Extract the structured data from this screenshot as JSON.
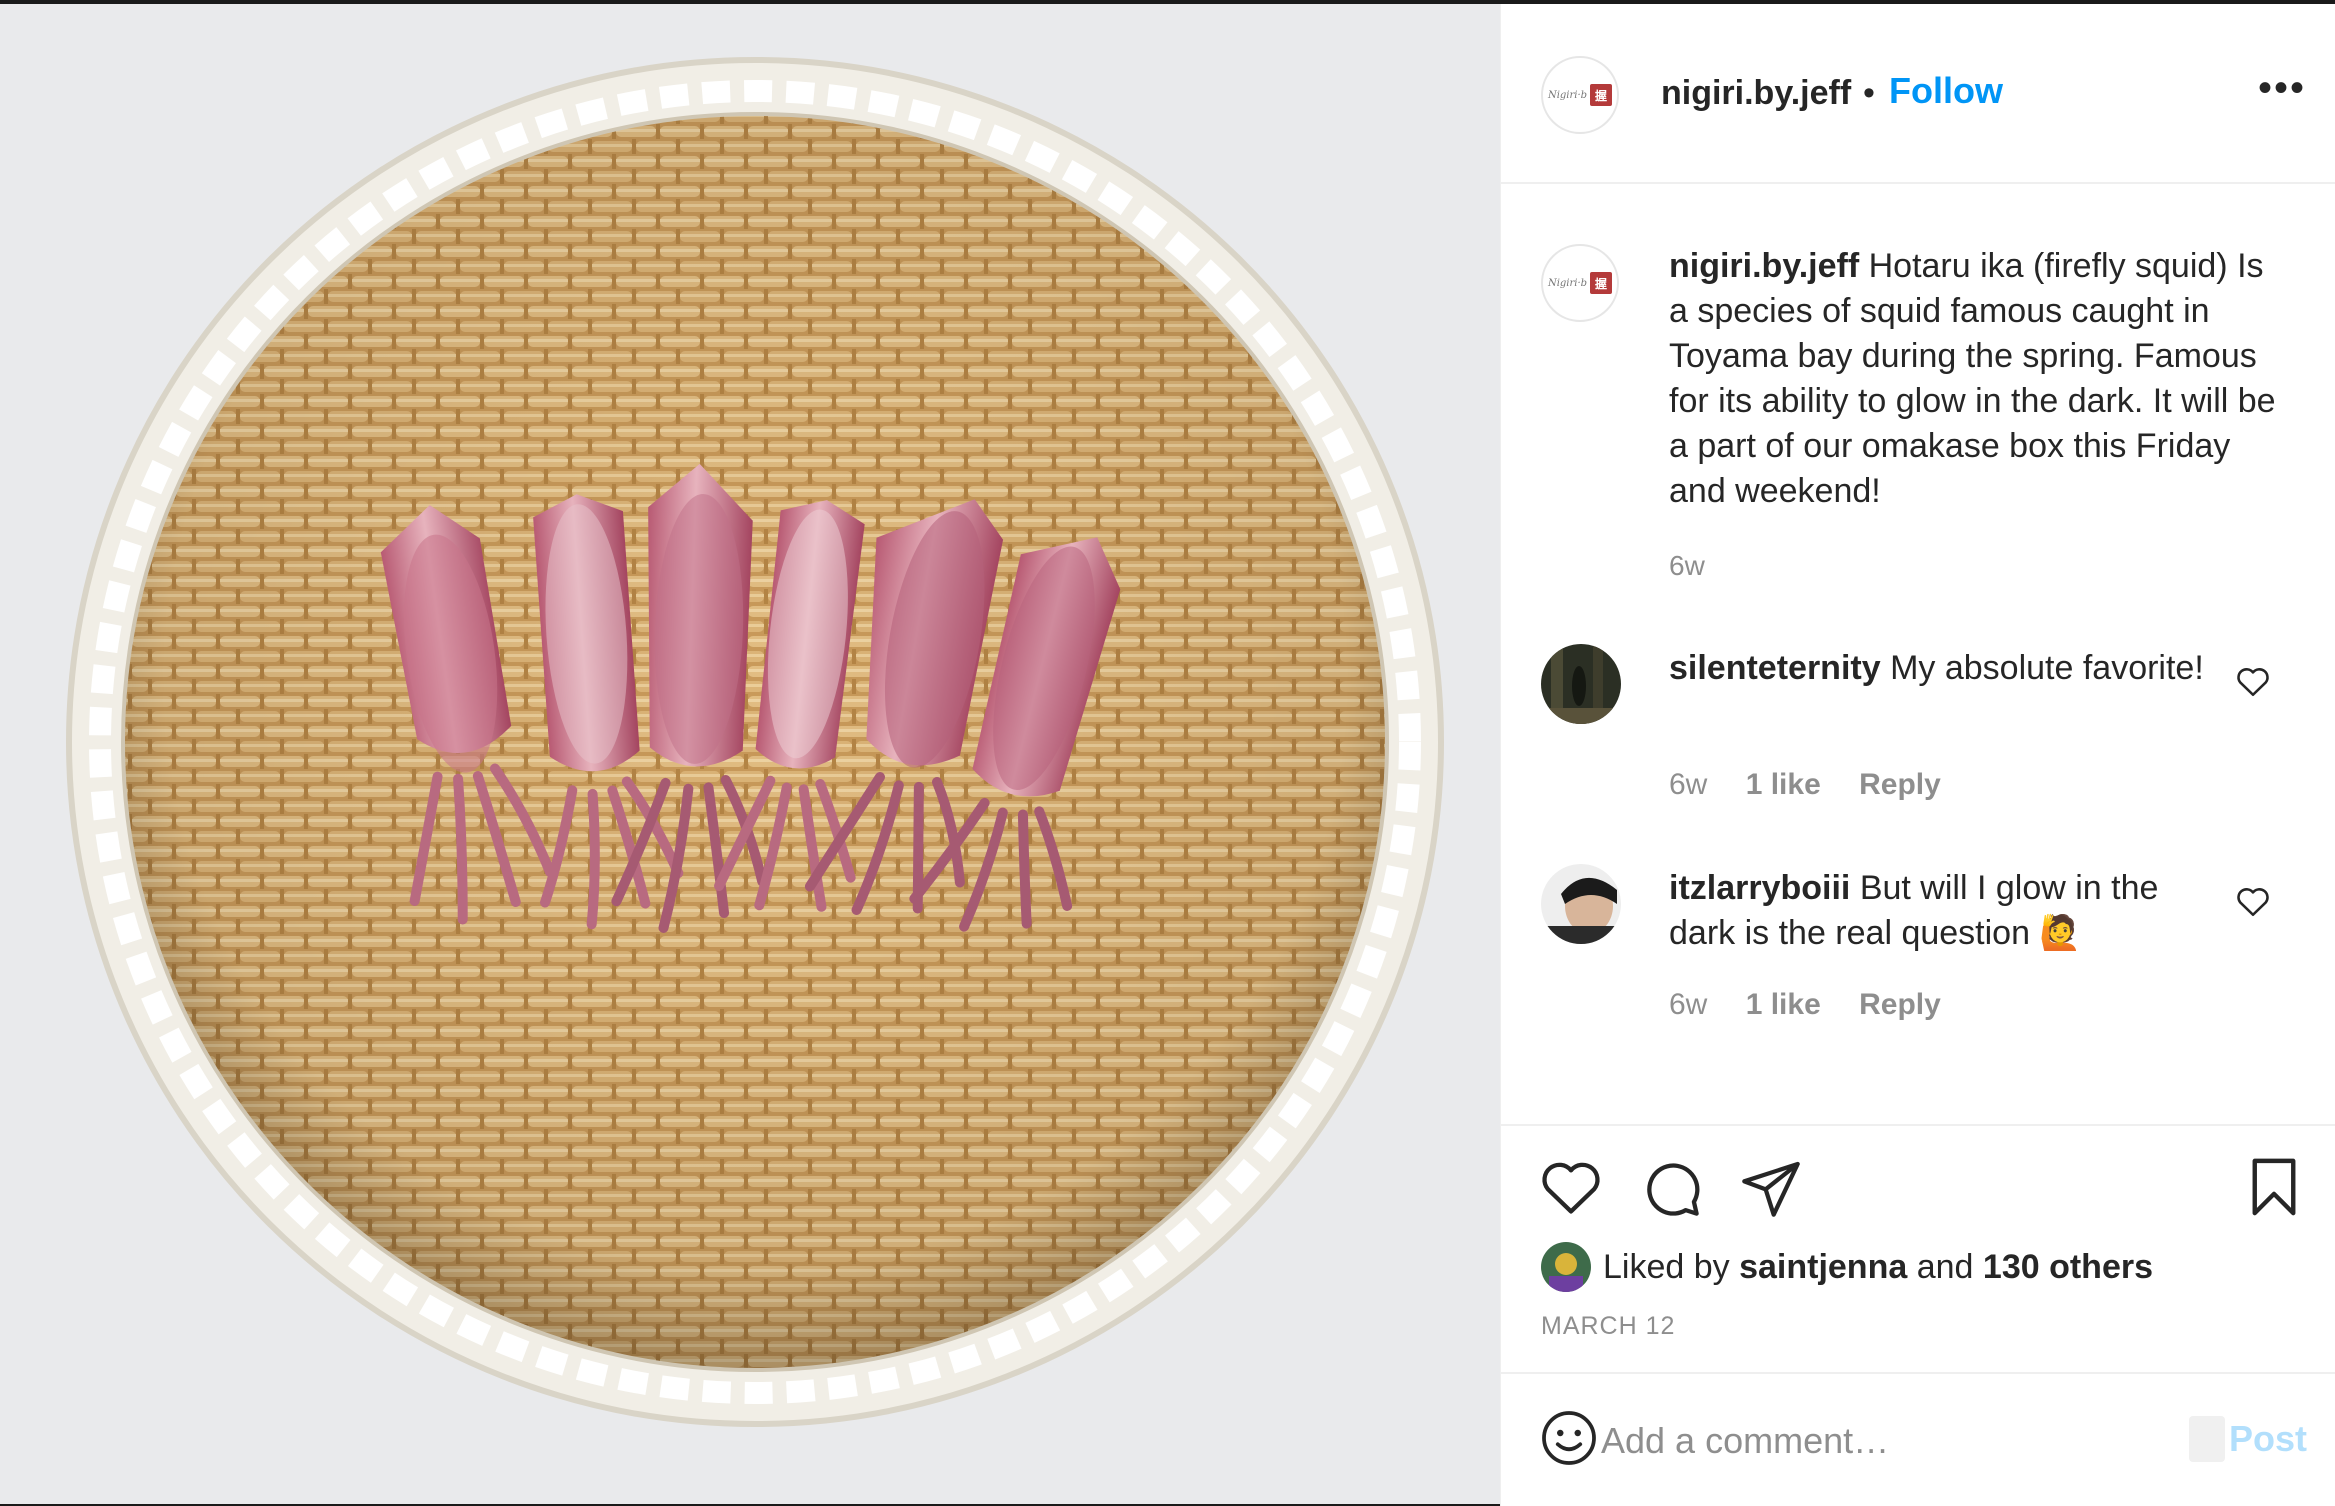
{
  "post": {
    "username": "nigiri.by.jeff",
    "follow_label": "Follow",
    "dot": "•",
    "more_label": "•••",
    "brand_avatar_script": "Nigiri·b",
    "brand_avatar_mark": "握"
  },
  "caption": {
    "username": "nigiri.by.jeff",
    "text": "Hotaru ika (firefly squid) Is a species of squid famous caught in Toyama bay during the spring. Famous for its ability to glow in the dark. It will be a part of our omakase box this Friday and weekend!",
    "time": "6w"
  },
  "comments": [
    {
      "username": "silenteternity",
      "text": "My absolute favorite!",
      "time": "6w",
      "likes": "1 like",
      "reply": "Reply"
    },
    {
      "username": "itzlarryboiii",
      "text": "But will I glow in the dark is the real question 🙋",
      "time": "6w",
      "likes": "1 like",
      "reply": "Reply"
    }
  ],
  "actions": {
    "liked_prefix": "Liked by",
    "liked_user": "saintjenna",
    "liked_and": "and",
    "liked_others": "130 others",
    "date": "MARCH 12"
  },
  "add_comment": {
    "placeholder": "Add a comment…",
    "post_label": "Post"
  },
  "icons": {
    "like": "heart-icon",
    "comment": "comment-icon",
    "share": "paper-plane-icon",
    "save": "bookmark-icon",
    "emoji": "smiley-icon"
  },
  "colors": {
    "accent": "#0095f6",
    "post_disabled": "#b2dffc",
    "muted": "#8e8e8e"
  }
}
